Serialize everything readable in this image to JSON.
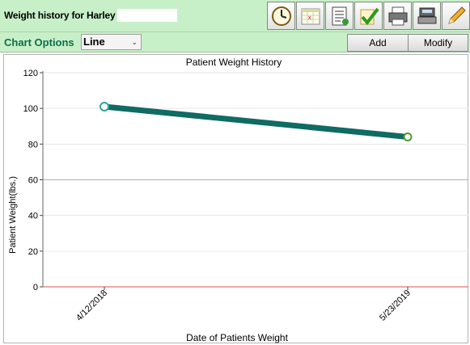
{
  "header": {
    "title": "Weight history for Harley",
    "toolbar": [
      {
        "icon": "clock-icon"
      },
      {
        "icon": "calendar-icon"
      },
      {
        "icon": "document-list-icon"
      },
      {
        "icon": "checkmark-icon"
      },
      {
        "icon": "printer-icon"
      },
      {
        "icon": "scale-icon"
      },
      {
        "icon": "pencil-icon"
      }
    ]
  },
  "options": {
    "label": "Chart Options",
    "chart_type": "Line",
    "add_label": "Add",
    "modify_label": "Modify"
  },
  "chart_data": {
    "type": "line",
    "title": "Patient Weight History",
    "xlabel": "Date of Patients Weight",
    "ylabel": "Patient Weight(lbs.)",
    "x": [
      "4/12/2018",
      "5/23/2019"
    ],
    "series": [
      {
        "values": [
          101,
          84
        ],
        "color": "#0f6b63"
      }
    ],
    "ylim": [
      0,
      120
    ],
    "yticks": [
      0,
      20,
      40,
      60,
      80,
      100,
      120
    ],
    "grid": true,
    "colors": {
      "baseline": "#e05050",
      "marker_first": "#2aa79b",
      "marker_last": "#4c9a2a"
    }
  }
}
